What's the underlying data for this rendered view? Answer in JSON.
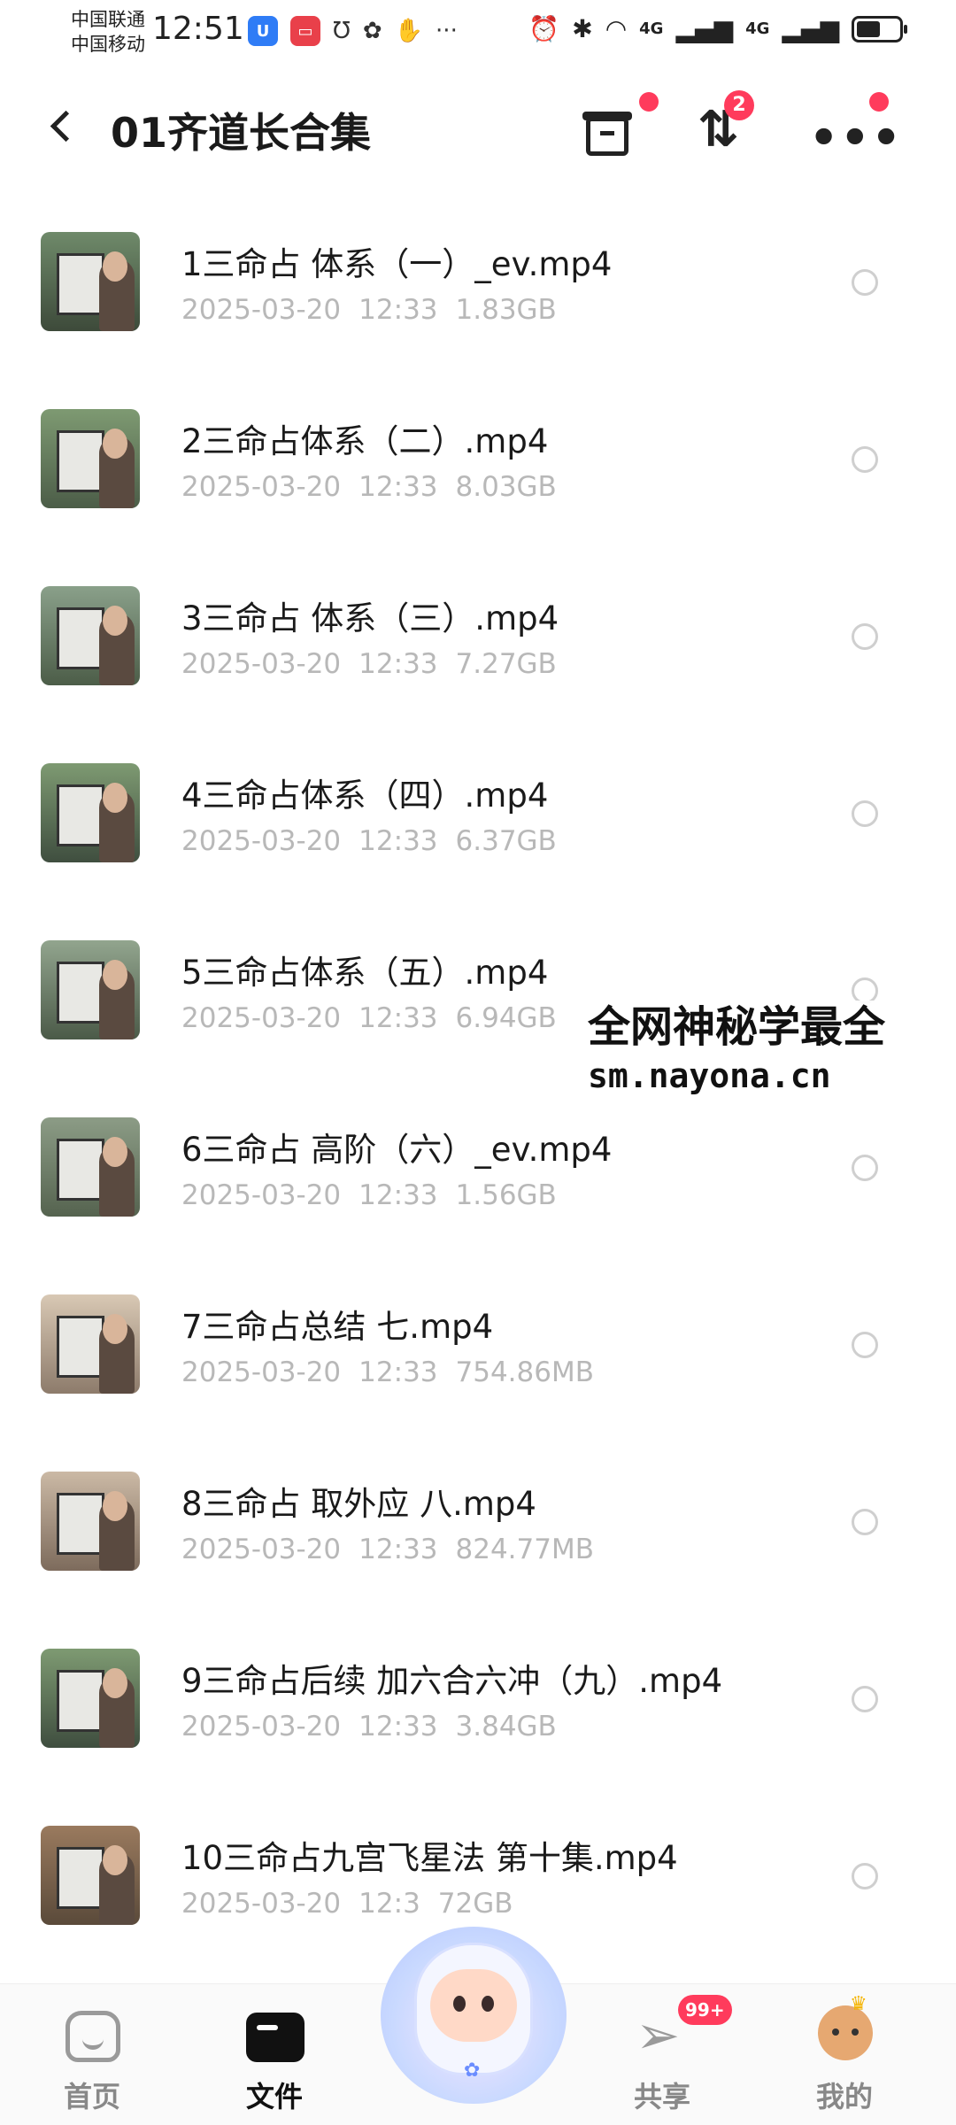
{
  "status_bar": {
    "carrier1": "中国联通",
    "carrier2": "中国移动",
    "time": "12:51",
    "more_glyph": "···",
    "signal1_label": "4G",
    "signal2_label": "4G"
  },
  "header": {
    "title": "01齐道长合集",
    "transfer_badge": "2"
  },
  "files": [
    {
      "name": "1三命占 体系（一）_ev.mp4",
      "date": "2025-03-20",
      "time": "12:33",
      "size": "1.83GB"
    },
    {
      "name": "2三命占体系（二）.mp4",
      "date": "2025-03-20",
      "time": "12:33",
      "size": "8.03GB"
    },
    {
      "name": "3三命占 体系（三）.mp4",
      "date": "2025-03-20",
      "time": "12:33",
      "size": "7.27GB"
    },
    {
      "name": "4三命占体系（四）.mp4",
      "date": "2025-03-20",
      "time": "12:33",
      "size": "6.37GB"
    },
    {
      "name": "5三命占体系（五）.mp4",
      "date": "2025-03-20",
      "time": "12:33",
      "size": "6.94GB"
    },
    {
      "name": "6三命占 高阶（六）_ev.mp4",
      "date": "2025-03-20",
      "time": "12:33",
      "size": "1.56GB"
    },
    {
      "name": "7三命占总结 七.mp4",
      "date": "2025-03-20",
      "time": "12:33",
      "size": "754.86MB"
    },
    {
      "name": "8三命占 取外应 八.mp4",
      "date": "2025-03-20",
      "time": "12:33",
      "size": "824.77MB"
    },
    {
      "name": "9三命占后续 加六合六冲（九）.mp4",
      "date": "2025-03-20",
      "time": "12:33",
      "size": "3.84GB"
    },
    {
      "name": "10三命占九宫飞星法  第十集.mp4",
      "date": "2025-03-20",
      "time": "12:3",
      "size": "72GB"
    }
  ],
  "watermark": {
    "line1": "全网神秘学最全",
    "line2": "sm.nayona.cn"
  },
  "bottom_nav": {
    "home": "首页",
    "files": "文件",
    "share": "共享",
    "share_badge": "99+",
    "me": "我的"
  },
  "colors": {
    "badge_red": "#ff3b5c",
    "meta_gray": "#b8b8b8"
  }
}
